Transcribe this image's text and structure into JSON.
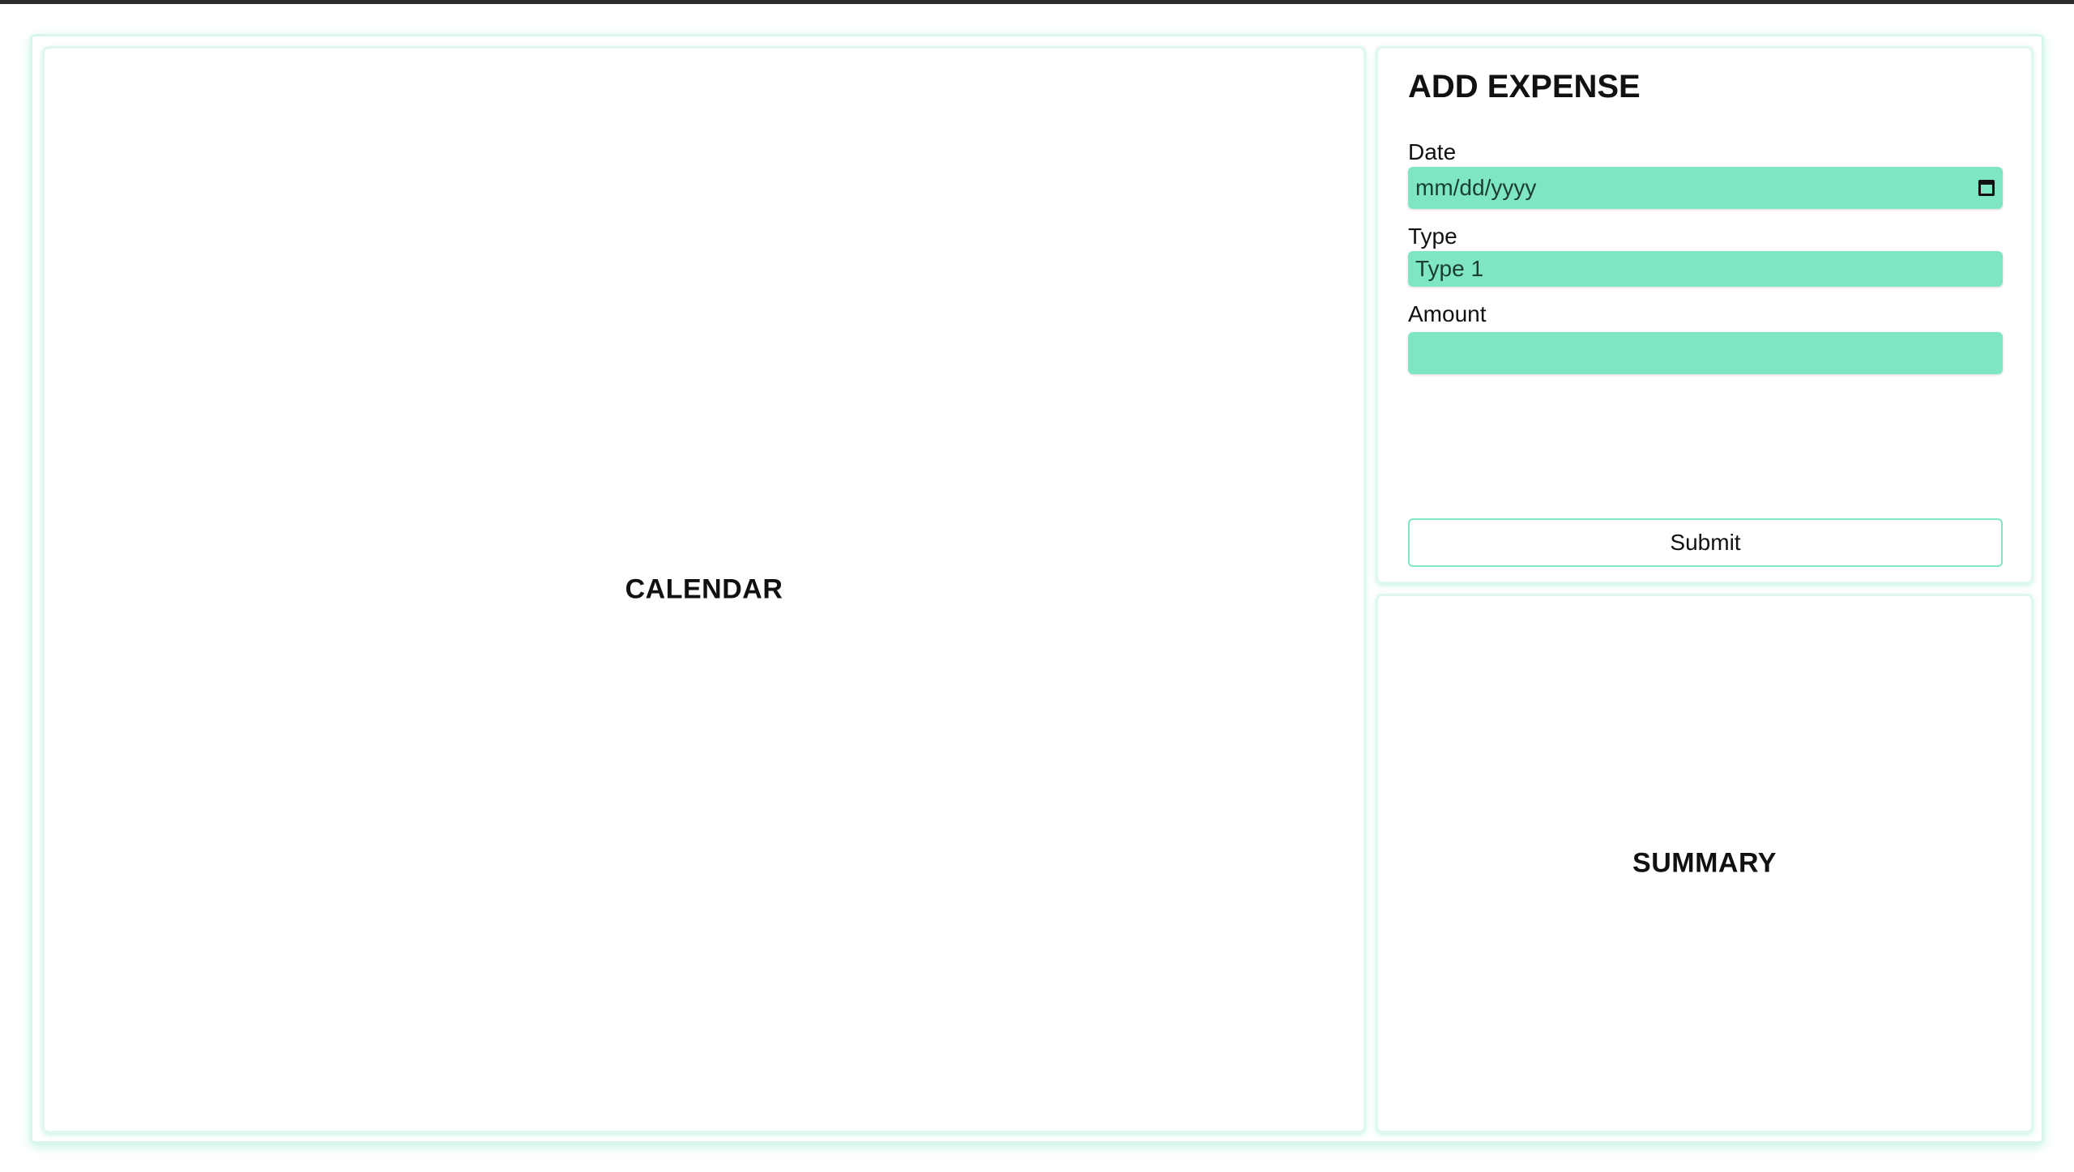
{
  "calendar": {
    "title": "CALENDAR"
  },
  "add_expense": {
    "title": "ADD EXPENSE",
    "date": {
      "label": "Date",
      "placeholder": "mm/dd/yyyy"
    },
    "type": {
      "label": "Type",
      "selected": "Type 1"
    },
    "amount": {
      "label": "Amount",
      "value": ""
    },
    "submit_label": "Submit"
  },
  "summary": {
    "title": "SUMMARY"
  },
  "colors": {
    "accent": "#7ee6c3",
    "top_bar": "#2d2d2d"
  },
  "icons": {
    "date_picker": "calendar-icon"
  }
}
